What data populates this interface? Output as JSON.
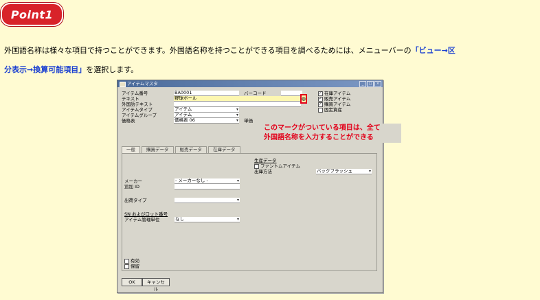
{
  "badge": "Point1",
  "intro": {
    "line1": "外国語名称は様々な項目で持つことができます。外国語名称を持つことができる項目を調べるためには、メニューバーの",
    "link1": "「ビュー→区",
    "link2": "分表示→換算可能項目」",
    "line2_end": "を選択します。"
  },
  "window": {
    "title": "アイテムマスタ",
    "controls": [
      "_",
      "□",
      "×"
    ],
    "fields": {
      "item_no": {
        "label": "アイテム番号",
        "value": "BA0001"
      },
      "text": {
        "label": "テキスト",
        "value": "野球ボール"
      },
      "foreign_text": {
        "label": "外国語テキスト",
        "value": ""
      },
      "item_type": {
        "label": "アイテムタイプ",
        "value": "アイテム"
      },
      "item_group": {
        "label": "アイテムグループ",
        "value": "アイテム"
      },
      "price_list": {
        "label": "価格表",
        "value": "価格表 06"
      },
      "barcode": {
        "label": "バーコード",
        "value": ""
      },
      "unit_price": {
        "label": "単価",
        "value": ""
      }
    },
    "checks": [
      {
        "label": "在庫アイテム",
        "checked": true
      },
      {
        "label": "販売アイテム",
        "checked": true
      },
      {
        "label": "購買アイテム",
        "checked": true
      },
      {
        "label": "固定資産",
        "checked": false
      }
    ],
    "globe_icon": "globe-icon",
    "callout_line1": "このマークがついている項目は、全て",
    "callout_line2": "外国語名称を入力することができる",
    "tabs": [
      "一般",
      "購買データ",
      "販売データ",
      "在庫データ"
    ],
    "panel": {
      "production_data": "生産データ",
      "phantom_item": "ファントムアイテム",
      "issue_method_label": "出庫方法",
      "issue_method_value": "バックフラッシュ",
      "maker_label": "メーカー",
      "maker_value": "- メーカーなし -",
      "extra_id_label": "追加 ID",
      "shipping_type_label": "出荷タイプ",
      "sn_batch_label": "SN およびロット番号",
      "item_mgmt_label": "アイテム管理単位",
      "item_mgmt_value": "なし",
      "active_label": "有効",
      "hold_label": "保留"
    },
    "ok_button": "OK",
    "cancel_button": "キャンセル"
  }
}
